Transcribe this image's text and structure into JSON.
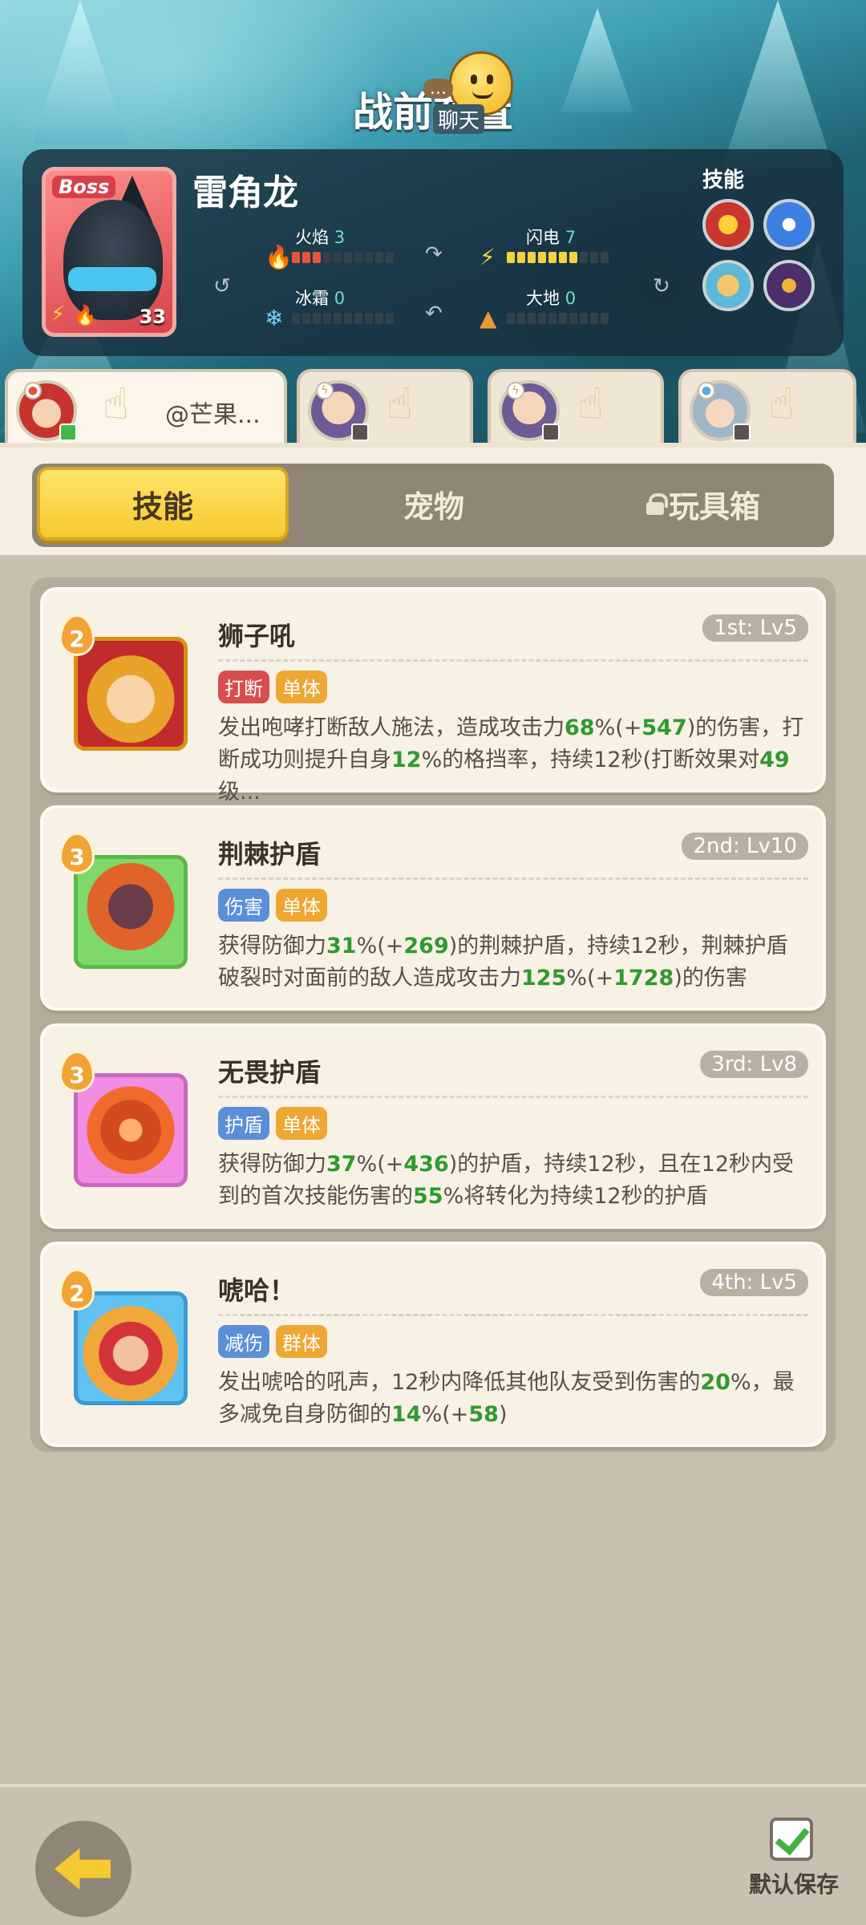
{
  "header": {
    "title": "战前布置",
    "chat_tag": "聊天",
    "dots": "..."
  },
  "boss": {
    "badge": "Boss",
    "level": "33",
    "name": "雷角龙",
    "stats": {
      "fire": {
        "label": "火焰",
        "value": "3",
        "level": 3
      },
      "lightning": {
        "label": "闪电",
        "value": "7",
        "level": 7
      },
      "ice": {
        "label": "冰霜",
        "value": "0",
        "level": 0
      },
      "earth": {
        "label": "大地",
        "value": "0",
        "level": 0
      }
    },
    "skills_title": "技能"
  },
  "heroes": [
    {
      "name": "@芒果..."
    },
    {
      "name": ""
    },
    {
      "name": ""
    },
    {
      "name": ""
    }
  ],
  "tabs": {
    "skills": "技能",
    "pets": "宠物",
    "toybox": "玩具箱"
  },
  "cards": [
    {
      "level_badge": "2",
      "name": "狮子吼",
      "rank": "1st: Lv5",
      "tags": [
        "打断",
        "单体"
      ],
      "desc": [
        {
          "t": "发出咆哮打断敌人施法，造成攻击力"
        },
        {
          "t": "68",
          "g": true
        },
        {
          "t": "%(+"
        },
        {
          "t": "547",
          "g": true
        },
        {
          "t": ")的伤害，打断成功则提升自身"
        },
        {
          "t": "12",
          "g": true
        },
        {
          "t": "%的格挡率，持续12秒(打断效果对"
        },
        {
          "t": "49",
          "g": true
        },
        {
          "t": "级..."
        }
      ]
    },
    {
      "level_badge": "3",
      "name": "荆棘护盾",
      "rank": "2nd: Lv10",
      "tags": [
        "伤害",
        "单体"
      ],
      "desc": [
        {
          "t": "获得防御力"
        },
        {
          "t": "31",
          "g": true
        },
        {
          "t": "%(+"
        },
        {
          "t": "269",
          "g": true
        },
        {
          "t": ")的荆棘护盾，持续12秒，荆棘护盾破裂时对面前的敌人造成攻击力"
        },
        {
          "t": "125",
          "g": true
        },
        {
          "t": "%(+"
        },
        {
          "t": "1728",
          "g": true
        },
        {
          "t": ")的伤害"
        }
      ]
    },
    {
      "level_badge": "3",
      "name": "无畏护盾",
      "rank": "3rd: Lv8",
      "tags": [
        "护盾",
        "单体"
      ],
      "desc": [
        {
          "t": "获得防御力"
        },
        {
          "t": "37",
          "g": true
        },
        {
          "t": "%(+"
        },
        {
          "t": "436",
          "g": true
        },
        {
          "t": ")的护盾，持续12秒，且在12秒内受到的首次技能伤害的"
        },
        {
          "t": "55",
          "g": true
        },
        {
          "t": "%将转化为持续12秒的护盾"
        }
      ]
    },
    {
      "level_badge": "2",
      "name": "唬哈！",
      "rank": "4th: Lv5",
      "tags": [
        "减伤",
        "群体"
      ],
      "desc": [
        {
          "t": "发出唬哈的吼声，12秒内降低其他队友受到伤害的"
        },
        {
          "t": "20",
          "g": true
        },
        {
          "t": "%，最多减免自身防御的"
        },
        {
          "t": "14",
          "g": true
        },
        {
          "t": "%(+"
        },
        {
          "t": "58",
          "g": true
        },
        {
          "t": ")"
        }
      ]
    }
  ],
  "bottom": {
    "save_label": "默认保存"
  },
  "colors": {
    "accent_yellow": "#f6c92f",
    "highlight_green": "#2f9a2f",
    "tag_red": "#d84e4e",
    "tag_blue": "#5a8fd8",
    "tag_orange": "#eda733"
  }
}
